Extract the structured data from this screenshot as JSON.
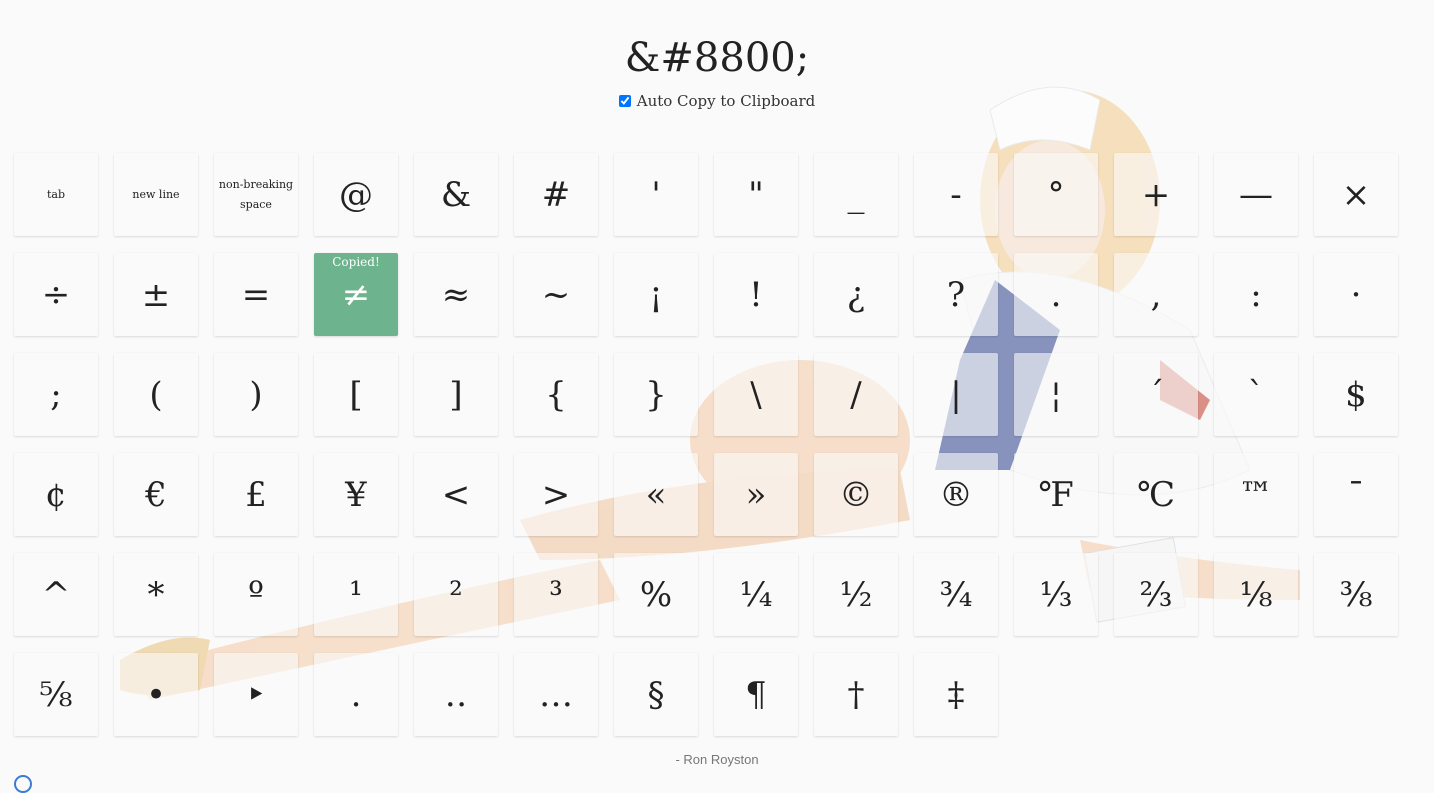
{
  "title": "&#8800;",
  "auto_copy": {
    "label": "Auto Copy to Clipboard",
    "checked": true
  },
  "copied_label": "Copied!",
  "copied_index": 17,
  "keys": [
    "tab",
    "new line",
    "non-breaking space",
    "@",
    "&",
    "#",
    "'",
    "\"",
    "_",
    "-",
    "°",
    "+",
    "—",
    "×",
    "÷",
    "±",
    "=",
    "≠",
    "≈",
    "~",
    "¡",
    "!",
    "¿",
    "?",
    ".",
    ",",
    ":",
    "·",
    ";",
    "(",
    ")",
    "[",
    "]",
    "{",
    "}",
    "\\",
    "/",
    "|",
    "¦",
    "´",
    "`",
    "$",
    "¢",
    "€",
    "£",
    "¥",
    "<",
    ">",
    "«",
    "»",
    "©",
    "®",
    "℉",
    "℃",
    "™",
    "¯",
    "^",
    "*",
    "º",
    "¹",
    "²",
    "³",
    "%",
    "¼",
    "½",
    "¾",
    "⅓",
    "⅔",
    "⅛",
    "⅜",
    "⅝",
    "•",
    "‣",
    "․",
    "‥",
    "…",
    "§",
    "¶",
    "†",
    "‡"
  ],
  "footer": "- Ron Royston"
}
